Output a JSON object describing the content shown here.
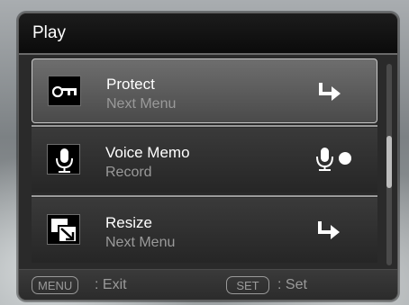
{
  "screen": {
    "title": "Play"
  },
  "menu": {
    "items": [
      {
        "label": "Protect",
        "sublabel": "Next Menu",
        "icon": "key-icon",
        "action_icon": "submenu-arrow-icon",
        "selected": true
      },
      {
        "label": "Voice Memo",
        "sublabel": "Record",
        "icon": "microphone-icon",
        "action_icon": "record-mic-icon",
        "selected": false
      },
      {
        "label": "Resize",
        "sublabel": "Next Menu",
        "icon": "resize-icon",
        "action_icon": "submenu-arrow-icon",
        "selected": false
      }
    ]
  },
  "footer": {
    "menu_key": "MENU",
    "menu_action": ": Exit",
    "set_key": "SET",
    "set_action": ": Set"
  },
  "colors": {
    "panel": "#2a2a2a",
    "title_bar": "#0b0b0b",
    "selected_item": "#6e6e6e",
    "text_primary": "#ffffff",
    "text_secondary": "#9a9a9a"
  }
}
